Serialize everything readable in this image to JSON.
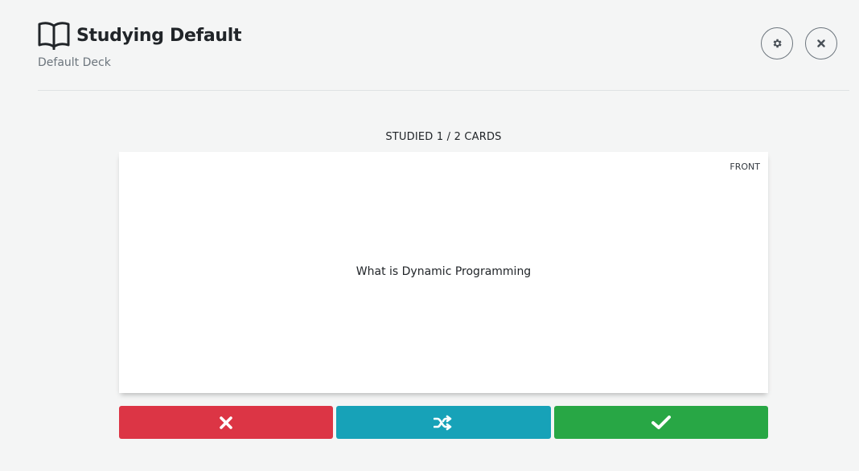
{
  "header": {
    "title": "Studying Default",
    "subtitle": "Default Deck",
    "icons": {
      "title": "book-open-icon",
      "settings": "gear-icon",
      "close": "close-icon"
    }
  },
  "progress": {
    "text": "STUDIED 1 / 2 CARDS",
    "studied": 1,
    "total": 2
  },
  "card": {
    "side_label": "FRONT",
    "content": "What is Dynamic Programming"
  },
  "actions": {
    "wrong": {
      "icon": "times-icon",
      "color": "#dc3545"
    },
    "shuffle": {
      "icon": "shuffle-icon",
      "color": "#17a2b8"
    },
    "correct": {
      "icon": "check-icon",
      "color": "#28a745"
    }
  }
}
